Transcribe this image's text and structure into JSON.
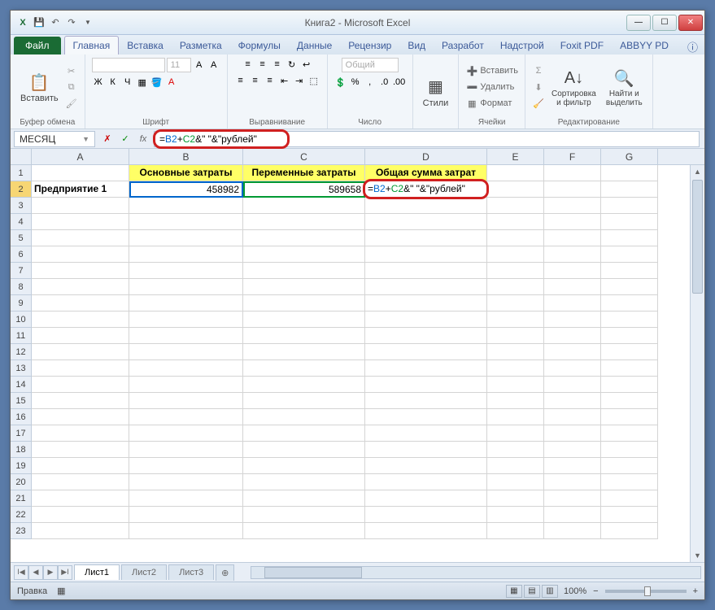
{
  "title": "Книга2 - Microsoft Excel",
  "qat": {
    "excel_icon": "X",
    "save": "💾",
    "undo": "↶",
    "redo": "↷"
  },
  "win": {
    "min": "—",
    "max": "☐",
    "close": "✕"
  },
  "tabs": {
    "file": "Файл",
    "items": [
      "Главная",
      "Вставка",
      "Разметка",
      "Формулы",
      "Данные",
      "Рецензир",
      "Вид",
      "Разработ",
      "Надстрой",
      "Foxit PDF",
      "ABBYY PD"
    ],
    "active_index": 0,
    "help": "ⓘ"
  },
  "ribbon": {
    "clipboard": {
      "label": "Буфер обмена",
      "paste": "Вставить",
      "paste_ico": "📋",
      "cut": "✂",
      "copy": "⧉",
      "brush": "🖌"
    },
    "font": {
      "label": "Шрифт",
      "bold": "Ж",
      "italic": "К",
      "underline": "Ч",
      "border": "▦",
      "fill": "🪣",
      "color": "A",
      "font_name": "",
      "font_size": "11"
    },
    "align": {
      "label": "Выравнивание",
      "top": "≡",
      "mid": "≡",
      "bot": "≡",
      "left": "≡",
      "center": "≡",
      "right": "≡",
      "wrap": "↩",
      "merge": "⬚",
      "indent_dec": "⇤",
      "indent_inc": "⇥"
    },
    "number": {
      "label": "Число",
      "format": "Общий",
      "currency": "💲",
      "percent": "%",
      "comma": ",",
      "inc_dec": ".0",
      "dec_dec": ".00"
    },
    "styles": {
      "label": "Стили",
      "btn": "Стили",
      "ico": "▦"
    },
    "cells": {
      "label": "Ячейки",
      "insert": "Вставить",
      "delete": "Удалить",
      "format": "Формат"
    },
    "editing": {
      "label": "Редактирование",
      "sum": "Σ",
      "fill": "⬇",
      "clear": "🧹",
      "sort": "Сортировка\nи фильтр",
      "find": "Найти и\nвыделить",
      "sort_ico": "A↓",
      "find_ico": "🔍"
    }
  },
  "namebox": {
    "value": "МЕСЯЦ"
  },
  "fx": {
    "cancel": "✗",
    "enter": "✓",
    "fx": "fx"
  },
  "formula": {
    "prefix": "=",
    "refB": "B2",
    "plus": "+",
    "refC": "C2",
    "suffix": "&\" \"&\"рублей\""
  },
  "columns": [
    "A",
    "B",
    "C",
    "D",
    "E",
    "F",
    "G"
  ],
  "rows": [
    "1",
    "2",
    "3",
    "4",
    "5",
    "6",
    "7",
    "8",
    "9",
    "10",
    "11",
    "12",
    "13",
    "14",
    "15",
    "16",
    "17",
    "18",
    "19",
    "20",
    "21",
    "22",
    "23"
  ],
  "headers": {
    "b1": "Основные затраты",
    "c1": "Переменные затраты",
    "d1": "Общая сумма затрат"
  },
  "data": {
    "a2": "Предприятие 1",
    "b2": "458982",
    "c2": "589658"
  },
  "sheets": {
    "active": "Лист1",
    "others": [
      "Лист2",
      "Лист3"
    ],
    "new": "⊕"
  },
  "status": {
    "mode": "Правка",
    "macro": "▦",
    "zoom": "100%",
    "minus": "−",
    "plus": "+"
  },
  "views": {
    "normal": "▦",
    "layout": "▤",
    "pagebreak": "▥"
  },
  "scroll": {
    "up": "▲",
    "down": "▼",
    "left": "◀",
    "right": "▶",
    "first": "I◀",
    "last": "▶I"
  }
}
